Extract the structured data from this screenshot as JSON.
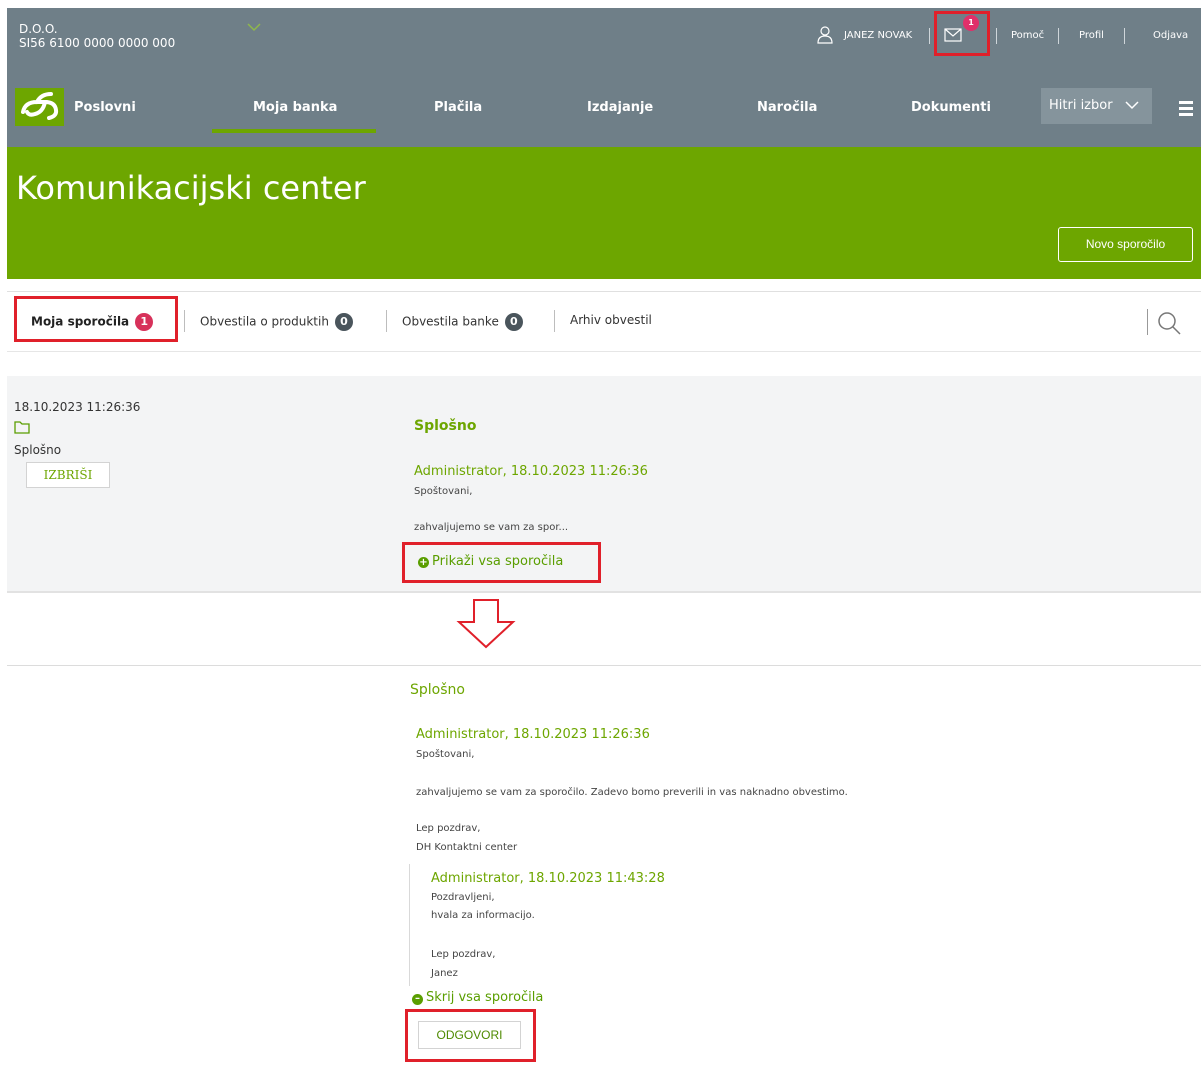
{
  "company": {
    "name": "D.O.O.",
    "account": "SI56 6100 0000 0000 000"
  },
  "header": {
    "user_name": "JANEZ NOVAK",
    "mail_count": "1",
    "help": "Pomoč",
    "profile": "Profil",
    "logout": "Odjava"
  },
  "nav": {
    "brand": "Poslovni",
    "items": [
      "Moja banka",
      "Plačila",
      "Izdajanje",
      "Naročila",
      "Dokumenti"
    ],
    "active_item": "Moja banka",
    "quick_select": "Hitri izbor"
  },
  "hero": {
    "title": "Komunikacijski center",
    "new_message_button": "Novo sporočilo"
  },
  "tabs": [
    {
      "label": "Moja sporočila",
      "count": "1"
    },
    {
      "label": "Obvestila o produktih",
      "count": "0"
    },
    {
      "label": "Obvestila banke",
      "count": "0"
    },
    {
      "label": "Arhiv obvestil"
    }
  ],
  "message": {
    "date": "18.10.2023 11:26:36",
    "category": "Splošno",
    "delete_button": "IZBRIŠI",
    "subject": "Splošno",
    "author": "Administrator, 18.10.2023 11:26:36",
    "greeting": "Spoštovani,",
    "preview": "zahvaljujemo se vam za spor...",
    "show_all": "Prikaži vsa sporočila"
  },
  "thread": {
    "subject": "Splošno",
    "first": {
      "author": "Administrator, 18.10.2023 11:26:36",
      "greeting": "Spoštovani,",
      "body": "zahvaljujemo se vam za sporočilo. Zadevo bomo preverili in vas naknadno obvestimo.",
      "closing": "Lep pozdrav,",
      "signature": "DH Kontaktni center"
    },
    "reply": {
      "author": "Administrator, 18.10.2023 11:43:28",
      "greeting": "Pozdravljeni,",
      "body": "hvala za informacijo.",
      "closing": "Lep pozdrav,",
      "signature": "Janez"
    },
    "hide_all": "Skrij vsa sporočila",
    "reply_button": "ODGOVORI"
  },
  "colors": {
    "brand_green": "#6da600",
    "header_grey": "#6f7f88",
    "highlight_red": "#e0202a",
    "badge_red": "#d7315a"
  }
}
